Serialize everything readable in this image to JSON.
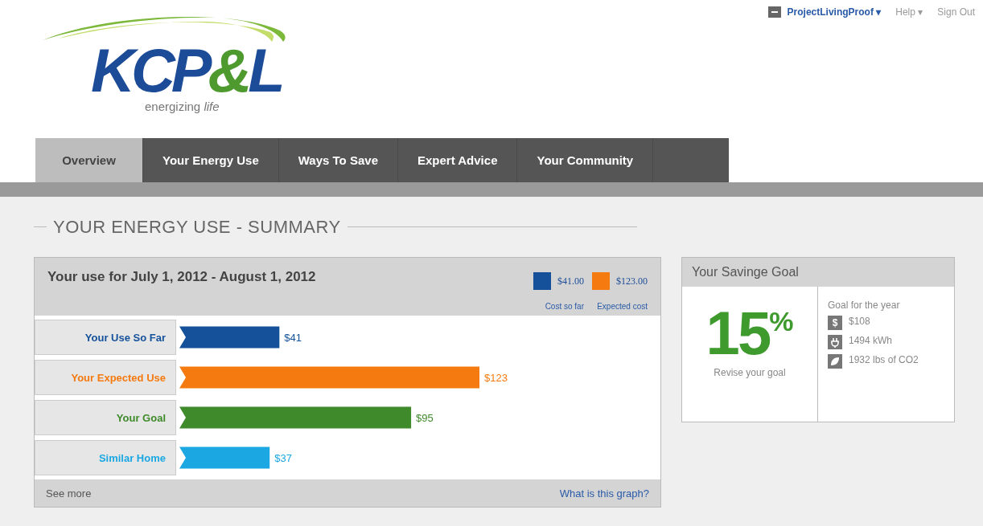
{
  "logo": {
    "parts": [
      {
        "text": "KCP",
        "color": "#1c4c97"
      },
      {
        "text": "&",
        "color": "#4f9a2e"
      },
      {
        "text": "L",
        "color": "#1c4c97"
      }
    ],
    "tagline": "energizing *life*"
  },
  "user_menu": [
    {
      "label": "ProjectLivingProof",
      "caret": "▾",
      "kind": "user"
    },
    {
      "label": "Help",
      "caret": "▾",
      "kind": "link"
    },
    {
      "label": "Sign Out",
      "kind": "link"
    }
  ],
  "tabs": [
    {
      "label": "Overview",
      "selected": true
    },
    {
      "label": "Your Energy Use",
      "selected": false
    },
    {
      "label": "Ways To Save",
      "selected": false
    },
    {
      "label": "Expert Advice",
      "selected": false
    },
    {
      "label": "Your Community",
      "selected": false
    }
  ],
  "section_title": "YOUR ENERGY USE - SUMMARY",
  "usage": {
    "title": "Your use for July 1, 2012 - August 1, 2012",
    "legend": [
      {
        "amount": "$41.00",
        "caption": "Cost so far",
        "color": "#14519a"
      },
      {
        "amount": "$123.00",
        "caption": "Expected cost",
        "color": "#f57a10"
      }
    ],
    "chart_data": {
      "type": "bar",
      "orientation": "horizontal",
      "categories": [
        "Your Use So Far",
        "Your Expected Use",
        "Your Goal",
        "Similar Home"
      ],
      "values": [
        41,
        123,
        95,
        37
      ],
      "value_labels": [
        "$41",
        "$123",
        "$95",
        "$37"
      ],
      "colors": [
        "#14519a",
        "#f57a10",
        "#3f8a2a",
        "#1ba7e2"
      ]
    },
    "see_more": "See more",
    "help_link": "What is this graph?"
  },
  "savings": {
    "title": "Your Savinge Goal",
    "percent": "15",
    "percent_sign": "%",
    "revise": "Revise your goal",
    "goal_heading": "Goal for the year",
    "goals": [
      {
        "kind": "money",
        "glyph": "$",
        "text": "$108"
      },
      {
        "kind": "energy",
        "text": "1494 kWh"
      },
      {
        "kind": "carbon",
        "text": "1932 lbs of CO2"
      }
    ]
  }
}
